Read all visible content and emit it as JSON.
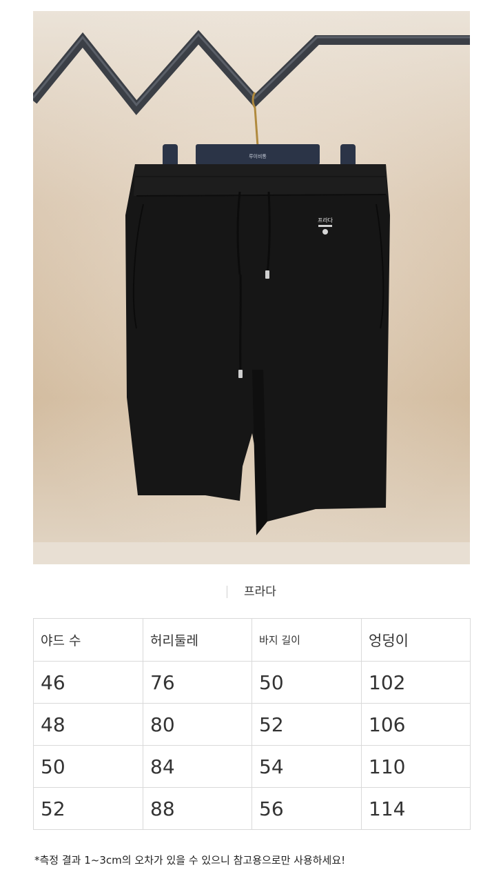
{
  "photo": {
    "hanger_label": "루이비통",
    "patch_text": "프라다"
  },
  "brand_caption": "프라다",
  "size_table": {
    "headers": [
      "야드 수",
      "허리둘레",
      "바지 길이",
      "엉덩이"
    ],
    "rows": [
      [
        "46",
        "76",
        "50",
        "102"
      ],
      [
        "48",
        "80",
        "52",
        "106"
      ],
      [
        "50",
        "84",
        "54",
        "110"
      ],
      [
        "52",
        "88",
        "56",
        "114"
      ]
    ]
  },
  "note": "*측정 결과 1~3cm의 오차가 있을 수 있으니 참고용으로만 사용하세요!",
  "colors": {
    "wall_light": "#e6dbcc",
    "wall_warm": "#c9b193",
    "rail": "#3b3f46",
    "hanger": "#2b3447",
    "garment": "#161616",
    "table_border": "#d9d9d9"
  }
}
